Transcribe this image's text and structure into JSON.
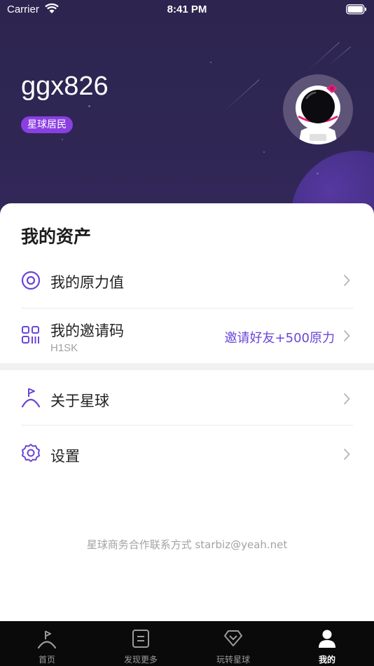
{
  "status_bar": {
    "carrier": "Carrier",
    "time": "8:41 PM"
  },
  "profile": {
    "username": "ggx826",
    "badge": "星球居民"
  },
  "assets": {
    "title": "我的资产",
    "items": [
      {
        "label": "我的原力值",
        "icon": "target-icon"
      },
      {
        "label": "我的邀请码",
        "sub": "H1SK",
        "extra": "邀请好友+500原力",
        "icon": "qr-code-icon"
      }
    ]
  },
  "more": {
    "items": [
      {
        "label": "关于星球",
        "icon": "flag-person-icon"
      },
      {
        "label": "设置",
        "icon": "gear-icon"
      }
    ]
  },
  "footer": {
    "text": "星球商务合作联系方式 starbiz@yeah.net"
  },
  "tabbar": {
    "tabs": [
      {
        "label": "首页",
        "icon": "home-flag-icon",
        "active": false
      },
      {
        "label": "发现更多",
        "icon": "document-icon",
        "active": false
      },
      {
        "label": "玩转星球",
        "icon": "diamond-icon",
        "active": false
      },
      {
        "label": "我的",
        "icon": "person-icon",
        "active": true
      }
    ]
  },
  "colors": {
    "accent": "#6b45d6",
    "badge": "#8a3fe2",
    "header_bg": "#2d2550",
    "tabbar_bg": "#0a0a0a"
  }
}
